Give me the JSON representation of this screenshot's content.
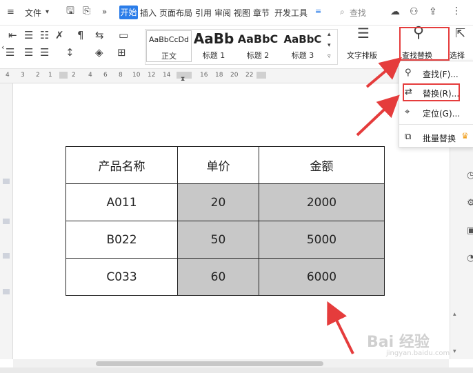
{
  "menu": {
    "file_label": "文件",
    "tabs": [
      "开始",
      "插入",
      "页面布局",
      "引用",
      "审阅",
      "视图",
      "章节",
      "开发工具"
    ],
    "search_label": "查找"
  },
  "ribbon": {
    "styles": [
      {
        "sample": "AaBbCcDd",
        "name": "正文"
      },
      {
        "sample": "AaBb",
        "name": "标题 1"
      },
      {
        "sample": "AaBbC",
        "name": "标题 2"
      },
      {
        "sample": "AaBbC",
        "name": "标题 3"
      }
    ],
    "text_layout_label": "文字排版",
    "find_replace_label": "查找替换",
    "select_label": "选择"
  },
  "ruler": {
    "numbers": [
      "4",
      "3",
      "2",
      "1",
      "",
      "2",
      "4",
      "6",
      "8",
      "10",
      "12",
      "14",
      "16",
      "18",
      "20",
      "22"
    ]
  },
  "dropdown": {
    "items": [
      {
        "label": "查找(F)...",
        "icon": "search-icon"
      },
      {
        "label": "替换(R)...",
        "icon": "replace-icon"
      },
      {
        "label": "定位(G)...",
        "icon": "locate-icon"
      },
      {
        "label": "批量替换",
        "icon": "batch-replace-icon"
      }
    ]
  },
  "table": {
    "headers": [
      "产品名称",
      "单价",
      "金额"
    ],
    "rows": [
      [
        "A011",
        "20",
        "2000"
      ],
      [
        "B022",
        "50",
        "5000"
      ],
      [
        "C033",
        "60",
        "6000"
      ]
    ]
  },
  "watermark": {
    "text": "Bai 经验",
    "sub": "jingyan.baidu.com"
  },
  "colors": {
    "accent": "#2b7de9",
    "highlight_red": "#e53c3c",
    "shade": "#c8c8c8"
  }
}
